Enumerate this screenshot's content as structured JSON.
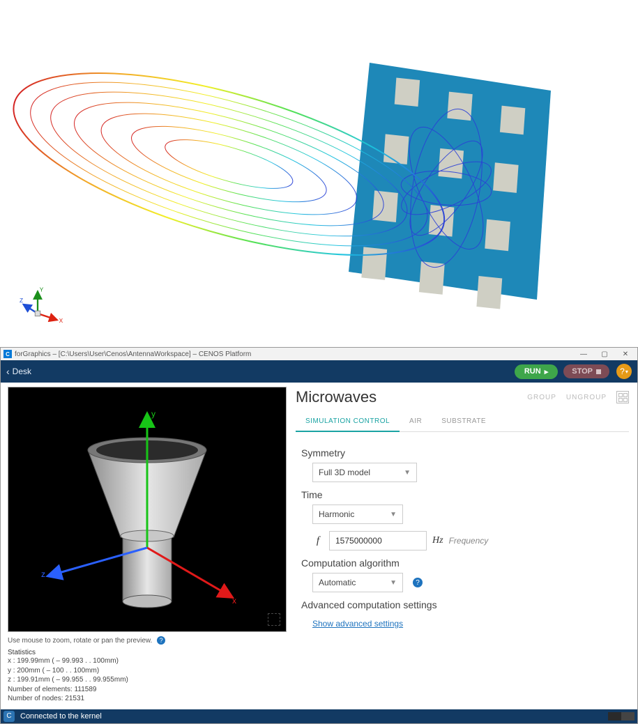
{
  "topViz": {
    "axes": {
      "x": "X",
      "y": "Y",
      "z": "Z"
    }
  },
  "window": {
    "title": "forGraphics – [C:\\Users\\User\\Cenos\\AntennaWorkspace] – CENOS Platform"
  },
  "toolbar": {
    "back": "Desk",
    "run": "RUN",
    "stop": "STOP"
  },
  "viewport": {
    "hint": "Use mouse to zoom, rotate or pan the preview.",
    "axes": {
      "x": "x",
      "y": "y",
      "z": "z"
    },
    "statsTitle": "Statistics",
    "stats": [
      "x : 199.99mm ( – 99.993 . . 100mm)",
      "y : 200mm ( – 100 . . 100mm)",
      "z : 199.91mm ( – 99.955 . . 99.955mm)",
      "Number of elements:  111589",
      "Number of nodes:  21531"
    ]
  },
  "panel": {
    "heading": "Microwaves",
    "group": "GROUP",
    "ungroup": "UNGROUP",
    "tabs": [
      "SIMULATION CONTROL",
      "AIR",
      "SUBSTRATE"
    ],
    "symmetry": {
      "label": "Symmetry",
      "value": "Full 3D model"
    },
    "time": {
      "label": "Time",
      "value": "Harmonic",
      "freqPrefix": "f",
      "freqValue": "1575000000",
      "freqUnit": "Hz",
      "freqLabel": "Frequency"
    },
    "algo": {
      "label": "Computation algorithm",
      "value": "Automatic"
    },
    "advanced": {
      "label": "Advanced computation settings",
      "link": "Show advanced settings"
    }
  },
  "status": {
    "text": "Connected to the kernel"
  }
}
